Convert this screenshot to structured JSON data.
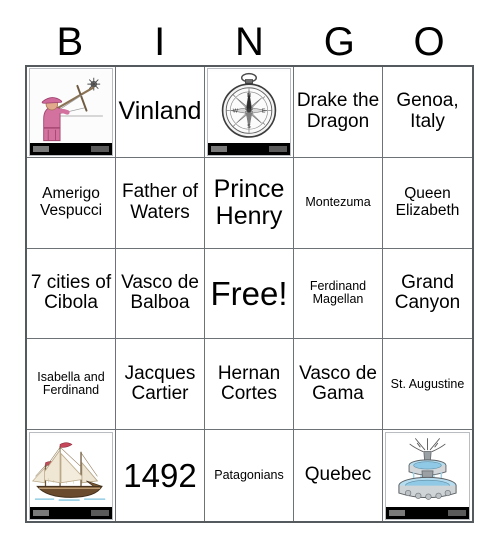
{
  "card": {
    "title": "BINGO Card",
    "header_letters": [
      "B",
      "I",
      "N",
      "G",
      "O"
    ],
    "rows": 5,
    "columns": 5,
    "free_space": "Free!",
    "border_color": "#555a5e",
    "grid_line_color": "#6d7276",
    "background_color": "#ffffff",
    "text_color": "#000000"
  },
  "cells": [
    {
      "id": "b1",
      "type": "image",
      "icon": "navigator-crossstaff-icon",
      "label": "navigator using cross-staff",
      "text": "",
      "size": ""
    },
    {
      "id": "i1",
      "type": "text",
      "icon": "",
      "label": "",
      "text": "Vinland",
      "size": "sz-l"
    },
    {
      "id": "n1",
      "type": "image",
      "icon": "compass-icon",
      "label": "mariner's compass",
      "text": "",
      "size": ""
    },
    {
      "id": "g1",
      "type": "text",
      "icon": "",
      "label": "",
      "text": "Drake the Dragon",
      "size": "sz-m"
    },
    {
      "id": "o1",
      "type": "text",
      "icon": "",
      "label": "",
      "text": "Genoa, Italy",
      "size": "sz-m"
    },
    {
      "id": "b2",
      "type": "text",
      "icon": "",
      "label": "",
      "text": "Amerigo Vespucci",
      "size": "sz-s"
    },
    {
      "id": "i2",
      "type": "text",
      "icon": "",
      "label": "",
      "text": "Father of Waters",
      "size": "sz-m"
    },
    {
      "id": "n2",
      "type": "text",
      "icon": "",
      "label": "",
      "text": "Prince Henry",
      "size": "sz-l"
    },
    {
      "id": "g2",
      "type": "text",
      "icon": "",
      "label": "",
      "text": "Montezuma",
      "size": "sz-xs"
    },
    {
      "id": "o2",
      "type": "text",
      "icon": "",
      "label": "",
      "text": "Queen Elizabeth",
      "size": "sz-s"
    },
    {
      "id": "b3",
      "type": "text",
      "icon": "",
      "label": "",
      "text": "7 cities of Cibola",
      "size": "sz-m"
    },
    {
      "id": "i3",
      "type": "text",
      "icon": "",
      "label": "",
      "text": "Vasco de Balboa",
      "size": "sz-m"
    },
    {
      "id": "n3",
      "type": "text",
      "icon": "",
      "label": "",
      "text": "Free!",
      "size": "sz-xl"
    },
    {
      "id": "g3",
      "type": "text",
      "icon": "",
      "label": "",
      "text": "Ferdinand Magellan",
      "size": "sz-xs"
    },
    {
      "id": "o3",
      "type": "text",
      "icon": "",
      "label": "",
      "text": "Grand Canyon",
      "size": "sz-m"
    },
    {
      "id": "b4",
      "type": "text",
      "icon": "",
      "label": "",
      "text": "Isabella and Ferdinand",
      "size": "sz-xs"
    },
    {
      "id": "i4",
      "type": "text",
      "icon": "",
      "label": "",
      "text": "Jacques Cartier",
      "size": "sz-m"
    },
    {
      "id": "n4",
      "type": "text",
      "icon": "",
      "label": "",
      "text": "Hernan Cortes",
      "size": "sz-m"
    },
    {
      "id": "g4",
      "type": "text",
      "icon": "",
      "label": "",
      "text": "Vasco de Gama",
      "size": "sz-m"
    },
    {
      "id": "o4",
      "type": "text",
      "icon": "",
      "label": "",
      "text": "St. Augustine",
      "size": "sz-xs"
    },
    {
      "id": "b5",
      "type": "image",
      "icon": "caravel-ship-icon",
      "label": "caravel sailing ship",
      "text": "",
      "size": ""
    },
    {
      "id": "i5",
      "type": "text",
      "icon": "",
      "label": "",
      "text": "1492",
      "size": "sz-xl"
    },
    {
      "id": "n5",
      "type": "text",
      "icon": "",
      "label": "",
      "text": "Patagonians",
      "size": "sz-xs"
    },
    {
      "id": "g5",
      "type": "text",
      "icon": "",
      "label": "",
      "text": "Quebec",
      "size": "sz-m"
    },
    {
      "id": "o5",
      "type": "image",
      "icon": "fountain-icon",
      "label": "fountain of youth",
      "text": "",
      "size": ""
    }
  ]
}
